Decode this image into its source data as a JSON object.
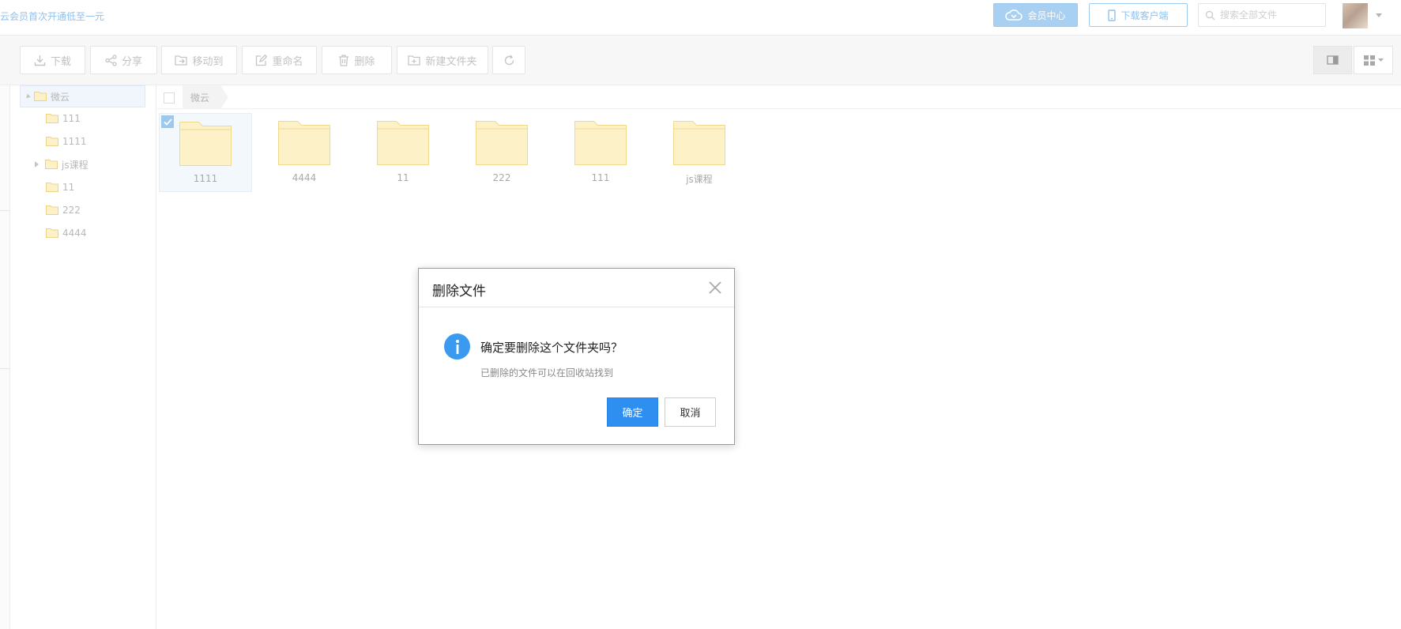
{
  "header": {
    "promo_text": "云会员首次开通低至一元",
    "vip_label": "会员中心",
    "download_client_label": "下载客户端",
    "search_placeholder": "搜索全部文件"
  },
  "toolbar": {
    "download": "下载",
    "share": "分享",
    "move_to": "移动到",
    "rename": "重命名",
    "delete": "删除",
    "new_folder": "新建文件夹"
  },
  "sidebar": {
    "root_label": "微云",
    "items": [
      {
        "label": "111"
      },
      {
        "label": "1111"
      },
      {
        "label": "js课程"
      },
      {
        "label": "11"
      },
      {
        "label": "222"
      },
      {
        "label": "4444"
      }
    ]
  },
  "main": {
    "breadcrumb": "微云",
    "folders": [
      {
        "name": "1111",
        "selected": true
      },
      {
        "name": "4444",
        "selected": false
      },
      {
        "name": "11",
        "selected": false
      },
      {
        "name": "222",
        "selected": false
      },
      {
        "name": "111",
        "selected": false
      },
      {
        "name": "js课程",
        "selected": false
      }
    ]
  },
  "dialog": {
    "title": "删除文件",
    "message": "确定要删除这个文件夹吗？",
    "sub_message": "已删除的文件可以在回收站找到",
    "ok_label": "确定",
    "cancel_label": "取消"
  },
  "colors": {
    "accent": "#2e8ff0",
    "accent_light": "#a8d0f3",
    "folder_fill": "#fdf1c8",
    "folder_stroke": "#f3dc94"
  }
}
